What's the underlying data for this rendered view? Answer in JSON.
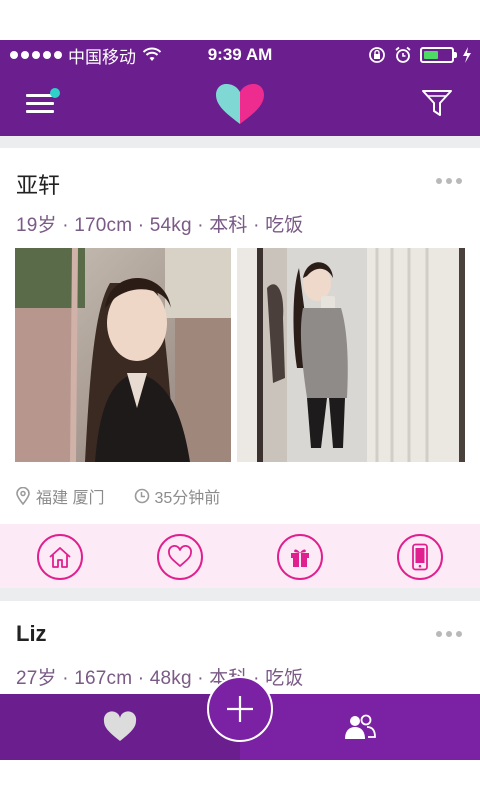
{
  "status_bar": {
    "carrier": "中国移动",
    "time": "9:39 AM",
    "battery_level": 0.55
  },
  "nav": {
    "menu_icon": "hamburger-menu-icon",
    "logo_icon": "heart-logo-icon",
    "filter_icon": "funnel-filter-icon"
  },
  "cards": [
    {
      "name": "亚轩",
      "info": "19岁 · 170cm · 54kg · 本科 · 吃饭",
      "location": "福建 厦门",
      "time_ago": "35分钟前"
    },
    {
      "name": "Liz",
      "info": "27岁 · 167cm · 48kg · 本科 · 吃饭"
    }
  ],
  "colors": {
    "primary_purple": "#6b1e8e",
    "secondary_purple": "#7b21a4",
    "accent_pink": "#e0208f",
    "accent_teal": "#2fd2c9",
    "action_bar_bg": "#fcebf6"
  }
}
